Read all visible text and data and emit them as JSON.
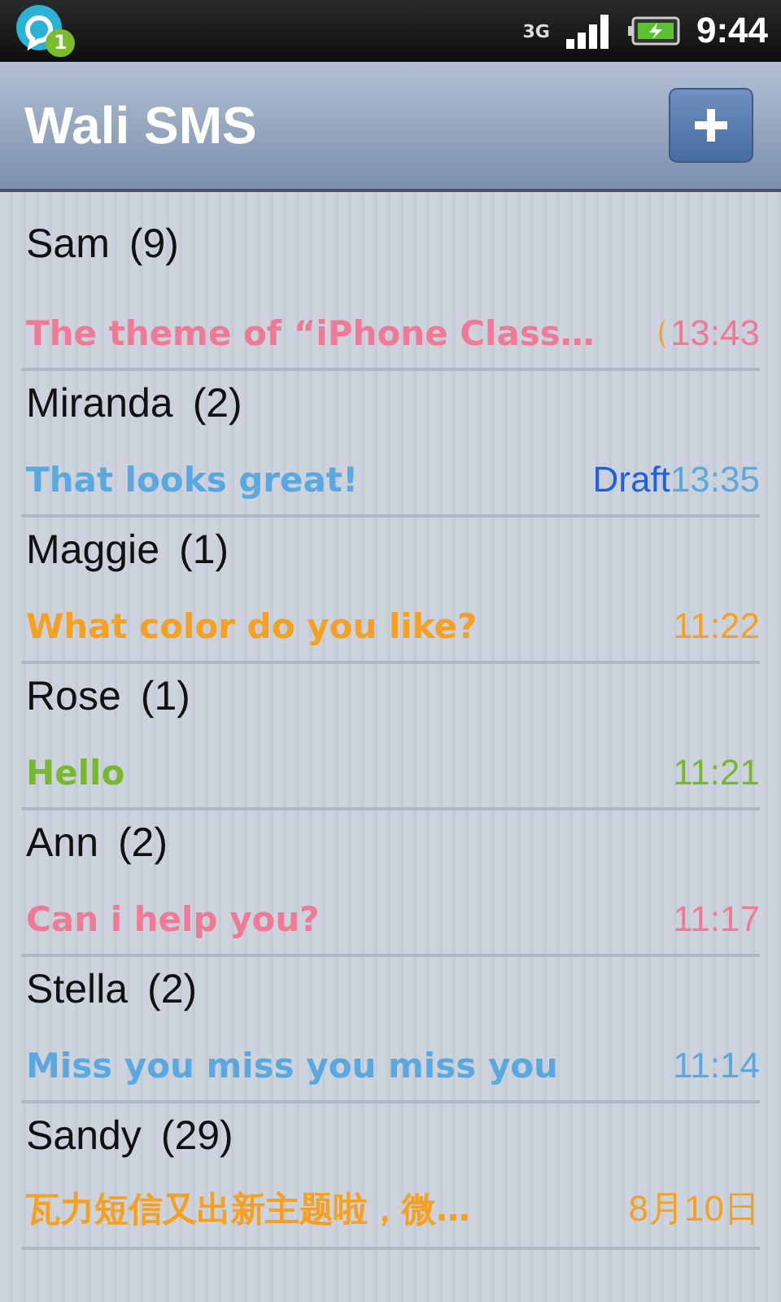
{
  "status_bar": {
    "notification_count": "1",
    "network": "3G",
    "time": "9:44"
  },
  "app_bar": {
    "title": "Wali SMS"
  },
  "conversations": [
    {
      "name": "Sam",
      "count": "(9)",
      "preview": "The theme of “iPhone Class…",
      "time": "13:43",
      "color": "#f07a96",
      "flag": true
    },
    {
      "name": "Miranda",
      "count": "(2)",
      "preview": "That looks great!",
      "draft": "Draft",
      "time": "13:35",
      "color": "#5aa8e0",
      "flag": false
    },
    {
      "name": "Maggie",
      "count": "(1)",
      "preview": "What color do you like?",
      "time": "11:22",
      "color": "#f5a020",
      "flag": false
    },
    {
      "name": "Rose",
      "count": "(1)",
      "preview": "Hello",
      "time": "11:21",
      "color": "#78b830",
      "flag": false
    },
    {
      "name": "Ann",
      "count": "(2)",
      "preview": "Can i help you?",
      "time": "11:17",
      "color": "#f07a96",
      "flag": false
    },
    {
      "name": "Stella",
      "count": "(2)",
      "preview": "Miss you miss you miss you",
      "time": "11:14",
      "color": "#5aa8e0",
      "flag": false
    },
    {
      "name": "Sandy",
      "count": "(29)",
      "preview": "瓦力短信又出新主题啦，微…",
      "time": "8月10日",
      "color": "#f5a020",
      "flag": false
    }
  ]
}
